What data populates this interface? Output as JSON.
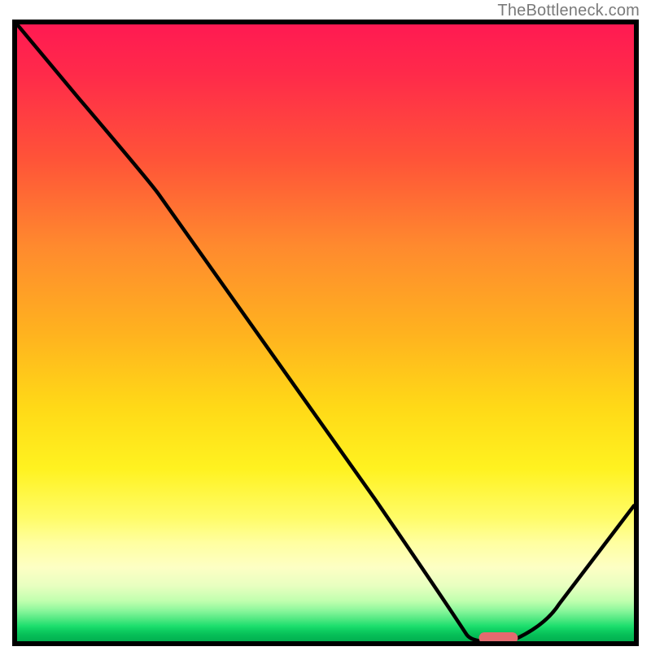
{
  "watermark": "TheBottleneck.com",
  "chart_data": {
    "type": "line",
    "title": "",
    "xlabel": "",
    "ylabel": "",
    "xlim": [
      0,
      100
    ],
    "ylim": [
      0,
      100
    ],
    "grid": false,
    "legend": false,
    "series": [
      {
        "name": "bottleneck-curve",
        "x": [
          0,
          10,
          22,
          42,
          58,
          68,
          73,
          76,
          80,
          88,
          96,
          100
        ],
        "values": [
          100,
          88,
          74,
          45,
          23,
          7,
          1,
          0,
          0,
          6,
          16,
          22
        ]
      }
    ],
    "markers": [
      {
        "name": "optimal-marker",
        "shape": "rounded-rect",
        "color": "#e46a6f",
        "x_start": 75,
        "x_end": 81,
        "y": 0
      }
    ],
    "background_gradient_stops": [
      {
        "pos": 0,
        "color": "#ff1a52"
      },
      {
        "pos": 0.5,
        "color": "#ffd917"
      },
      {
        "pos": 0.85,
        "color": "#fffc68"
      },
      {
        "pos": 1.0,
        "color": "#02b050"
      }
    ]
  }
}
